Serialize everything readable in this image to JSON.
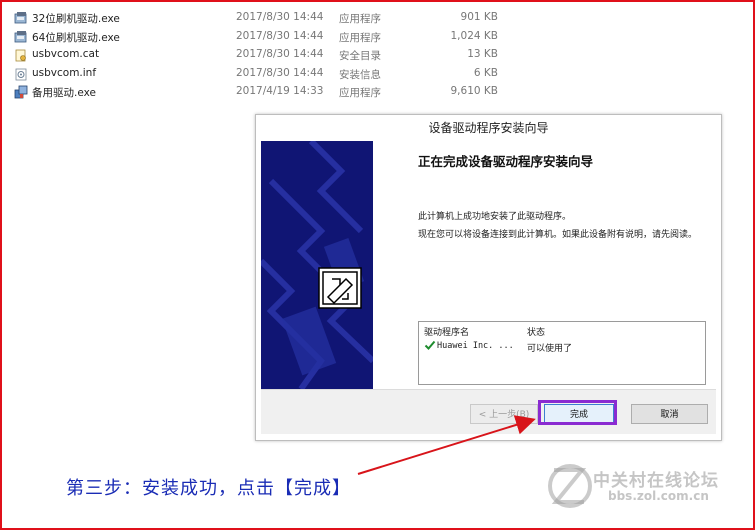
{
  "files": [
    {
      "name": "32位刷机驱动.exe",
      "date": "2017/8/30 14:44",
      "type": "应用程序",
      "size": "901 KB",
      "icon": "exe-icon"
    },
    {
      "name": "64位刷机驱动.exe",
      "date": "2017/8/30 14:44",
      "type": "应用程序",
      "size": "1,024 KB",
      "icon": "exe-icon"
    },
    {
      "name": "usbvcom.cat",
      "date": "2017/8/30 14:44",
      "type": "安全目录",
      "size": "13 KB",
      "icon": "catalog-icon"
    },
    {
      "name": "usbvcom.inf",
      "date": "2017/8/30 14:44",
      "type": "安装信息",
      "size": "6 KB",
      "icon": "inf-icon"
    },
    {
      "name": "备用驱动.exe",
      "date": "2017/4/19 14:33",
      "type": "应用程序",
      "size": "9,610 KB",
      "icon": "installer-icon"
    }
  ],
  "dialog": {
    "title": "设备驱动程序安装向导",
    "heading": "正在完成设备驱动程序安装向导",
    "para1": "此计算机上成功地安装了此驱动程序。",
    "para2": "现在您可以将设备连接到此计算机。如果此设备附有说明，请先阅读。",
    "table": {
      "col_name": "驱动程序名",
      "col_status": "状态",
      "rows": [
        {
          "name": "Huawei Inc. ...",
          "status": "可以使用了"
        }
      ]
    },
    "buttons": {
      "back": "< 上一步(B)",
      "finish": "完成",
      "cancel": "取消"
    }
  },
  "caption": "第三步：安装成功，点击【完成】",
  "watermark": {
    "line1": "中关村在线论坛",
    "line2": "bbs.zol.com.cn"
  },
  "colors": {
    "frame": "#e0101a",
    "banner": "#101574",
    "highlight": "#8a2bd1",
    "caption": "#1a2cb5",
    "check": "#1e8c2e"
  }
}
